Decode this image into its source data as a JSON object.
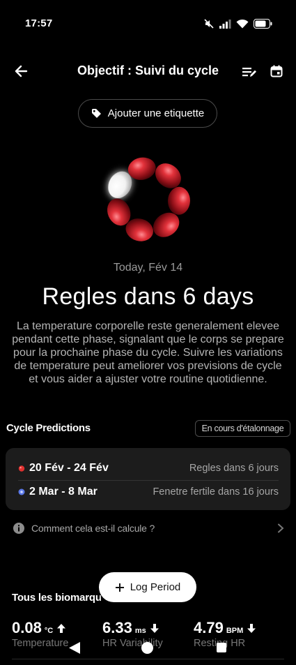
{
  "status_bar": {
    "time": "17:57",
    "icons": [
      "mute-icon",
      "signal-icon",
      "wifi-icon",
      "battery-icon"
    ]
  },
  "header": {
    "title": "Objectif : Suivi du cycle",
    "icons": [
      "back-arrow-icon",
      "edit-list-icon",
      "calendar-icon"
    ]
  },
  "tag_button": {
    "label": "Ajouter une etiquette",
    "icon": "tag-icon"
  },
  "today": {
    "date": "Today, Fév 14",
    "headline": "Regles dans 6 days",
    "description": "La temperature corporelle reste generalement elevee pendant cette phase, signalant que le corps se prepare pour la prochaine phase du cycle. Suivre les variations de temperature peut ameliorer vos previsions de cycle et vous aider a ajuster votre routine quotidienne."
  },
  "predictions": {
    "title": "Cycle Predictions",
    "badge": "En cours d'étalonnage",
    "rows": [
      {
        "range": "20 Fév - 24 Fév",
        "label": "Regles dans 6 jours",
        "icon": "period-drop-icon"
      },
      {
        "range": "2 Mar - 8 Mar",
        "label": "Fenetre fertile dans 16 jours",
        "icon": "fertile-window-icon"
      }
    ]
  },
  "calc_info": {
    "label": "Comment cela est-il calcule ?",
    "icon": "info-icon"
  },
  "log_button": {
    "label": "Log Period",
    "icon": "plus-icon"
  },
  "biomarkers": {
    "title": "Tous les biomarqu",
    "metrics": [
      {
        "value": "0.08",
        "unit": "°C",
        "trend": "up",
        "label": "Temperature"
      },
      {
        "value": "6.33",
        "unit": "ms",
        "trend": "down",
        "label": "HR Variability"
      },
      {
        "value": "4.79",
        "unit": "BPM",
        "trend": "down",
        "label": "Resting HR"
      }
    ]
  },
  "colors": {
    "background": "#000000",
    "card": "#1c1c1c",
    "period_red": "#e0312f",
    "fertile_blue": "#5b79e8",
    "muted_text": "#a6a6a6"
  },
  "cycle_ring": {
    "total_petals": 7,
    "current_petal": 1
  }
}
